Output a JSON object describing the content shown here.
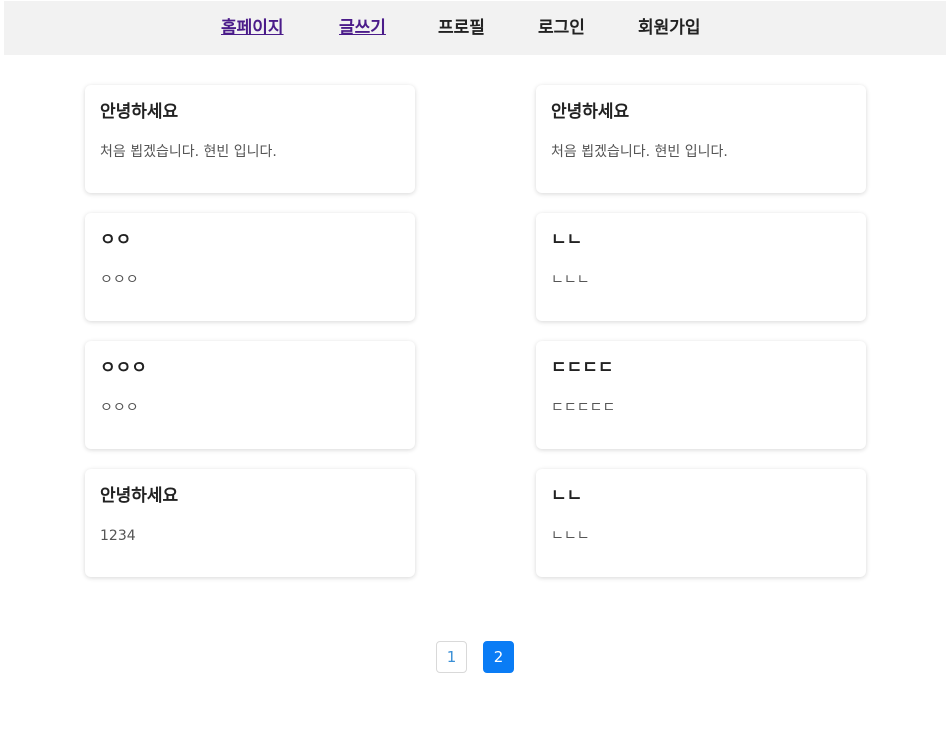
{
  "nav": {
    "items": [
      "홈페이지",
      "글쓰기",
      "프로필",
      "로그인",
      "회원가입"
    ]
  },
  "posts": [
    {
      "title": "안녕하세요",
      "body": "처음 뵙겠습니다. 현빈 입니다."
    },
    {
      "title": "안녕하세요",
      "body": "처음 뵙겠습니다. 현빈 입니다."
    },
    {
      "title": "ㅇㅇ",
      "body": "ㅇㅇㅇ"
    },
    {
      "title": "ㄴㄴ",
      "body": "ㄴㄴㄴ"
    },
    {
      "title": "ㅇㅇㅇ",
      "body": "ㅇㅇㅇ"
    },
    {
      "title": "ㄷㄷㄷㄷ",
      "body": "ㄷㄷㄷㄷㄷ"
    },
    {
      "title": "안녕하세요",
      "body": "1234"
    },
    {
      "title": "ㄴㄴ",
      "body": "ㄴㄴㄴ"
    }
  ],
  "pagination": {
    "pages": [
      "1",
      "2"
    ],
    "current": "2"
  },
  "colors": {
    "nav_bg": "#f2f2f2",
    "visited_link": "#4b1c8a",
    "active_page": "#0a7cf5",
    "page_link": "#3a8fd6"
  }
}
